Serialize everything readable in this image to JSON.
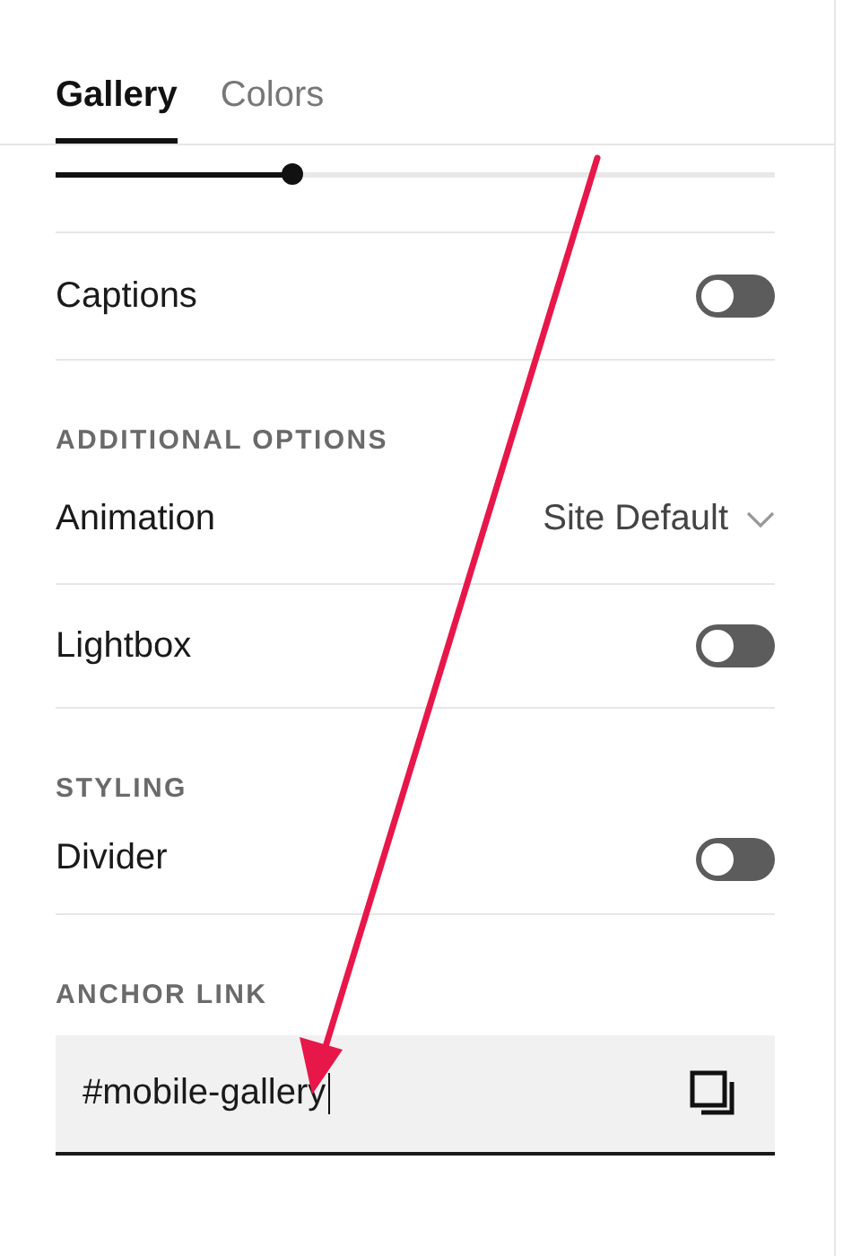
{
  "tabs": [
    {
      "label": "Gallery",
      "selected": true
    },
    {
      "label": "Colors",
      "selected": false
    }
  ],
  "rows": [
    {
      "kind": "slider",
      "level": 0.33
    },
    {
      "kind": "toggle",
      "label": "Captions",
      "on": false
    },
    {
      "kind": "heading",
      "label": "ADDITIONAL OPTIONS"
    },
    {
      "kind": "select",
      "label": "Animation",
      "value": "Site Default"
    },
    {
      "kind": "toggle",
      "label": "Lightbox",
      "on": false
    },
    {
      "kind": "heading",
      "label": "STYLING"
    },
    {
      "kind": "toggle",
      "label": "Divider",
      "on": false
    },
    {
      "kind": "heading",
      "label": "ANCHOR LINK"
    },
    {
      "kind": "field",
      "value": "#mobile-gallery"
    }
  ]
}
